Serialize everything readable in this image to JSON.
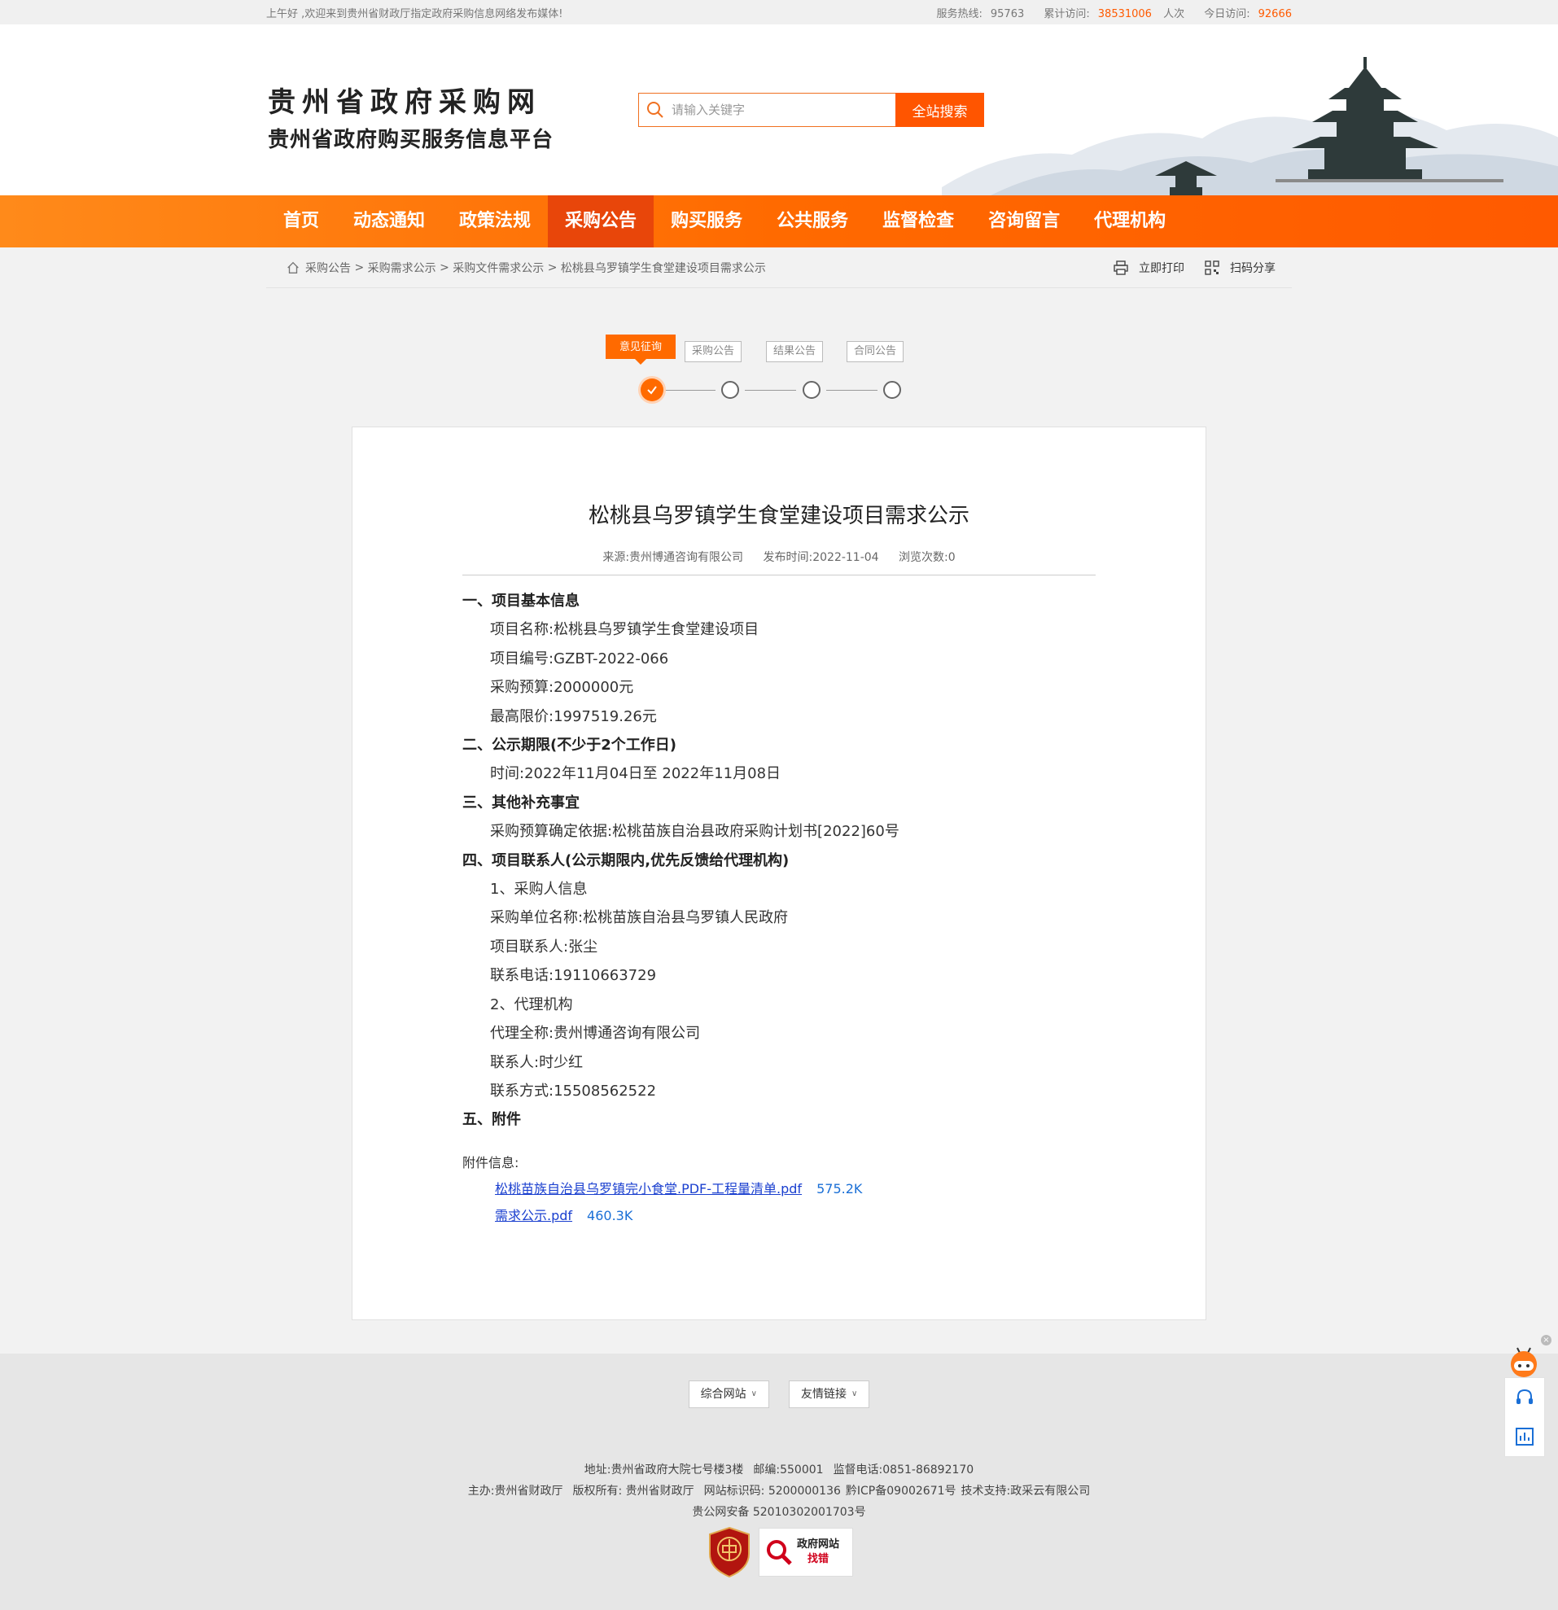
{
  "topbar": {
    "welcome": "上午好 ,欢迎来到贵州省财政厅指定政府采购信息网络发布媒体!",
    "hotline_label": "服务热线:",
    "hotline": "95763",
    "total_label": "累计访问:",
    "total_value": "38531006",
    "total_unit": "人次",
    "today_label": "今日访问:",
    "today_value": "92666"
  },
  "header": {
    "logo_line1": "贵州省政府采购网",
    "logo_line2": "贵州省政府购买服务信息平台",
    "search_placeholder": "请输入关键字",
    "search_button": "全站搜索"
  },
  "nav": {
    "items": [
      "首页",
      "动态通知",
      "政策法规",
      "采购公告",
      "购买服务",
      "公共服务",
      "监督检查",
      "咨询留言",
      "代理机构"
    ],
    "active_index": 3
  },
  "breadcrumb": {
    "c1": "采购公告",
    "c2": "采购需求公示",
    "c3": "采购文件需求公示",
    "c4": "松桃县乌罗镇学生食堂建设项目需求公示",
    "sep": ">",
    "print": "立即打印",
    "share": "扫码分享"
  },
  "steps": [
    "意见征询",
    "采购公告",
    "结果公告",
    "合同公告"
  ],
  "article": {
    "title": "松桃县乌罗镇学生食堂建设项目需求公示",
    "source": "来源:贵州博通咨询有限公司",
    "date": "发布时间:2022-11-04",
    "views": "浏览次数:0",
    "lines": [
      {
        "t": "h",
        "text": "一、项目基本信息"
      },
      {
        "t": "p",
        "text": "项目名称:松桃县乌罗镇学生食堂建设项目"
      },
      {
        "t": "p",
        "text": "项目编号:GZBT-2022-066"
      },
      {
        "t": "p",
        "text": "采购预算:2000000元"
      },
      {
        "t": "p",
        "text": "最高限价:1997519.26元"
      },
      {
        "t": "h",
        "text": "二、公示期限(不少于2个工作日)"
      },
      {
        "t": "p",
        "text": "时间:2022年11月04日至 2022年11月08日"
      },
      {
        "t": "h",
        "text": "三、其他补充事宜"
      },
      {
        "t": "p",
        "text": "采购预算确定依据:松桃苗族自治县政府采购计划书[2022]60号"
      },
      {
        "t": "h",
        "text": "四、项目联系人(公示期限内,优先反馈给代理机构)"
      },
      {
        "t": "p",
        "text": "1、采购人信息"
      },
      {
        "t": "p",
        "text": "采购单位名称:松桃苗族自治县乌罗镇人民政府"
      },
      {
        "t": "p",
        "text": "项目联系人:张尘"
      },
      {
        "t": "p",
        "text": "联系电话:19110663729"
      },
      {
        "t": "p",
        "text": "2、代理机构"
      },
      {
        "t": "p",
        "text": "代理全称:贵州博通咨询有限公司"
      },
      {
        "t": "p",
        "text": "联系人:时少红"
      },
      {
        "t": "p",
        "text": "联系方式:15508562522"
      },
      {
        "t": "h",
        "text": "五、附件"
      }
    ],
    "attach_title": "附件信息:",
    "attachments": [
      {
        "name": "松桃苗族自治县乌罗镇完小食堂.PDF-工程量清单.pdf",
        "size": "575.2K"
      },
      {
        "name": "需求公示.pdf",
        "size": "460.3K"
      }
    ]
  },
  "footer": {
    "btn1": "综合网站",
    "btn2": "友情链接",
    "addr": "地址:贵州省政府大院七号楼3楼",
    "zip": "邮编:550001",
    "tel": "监督电话:0851-86892170",
    "host": "主办:贵州省财政厅",
    "copy": "版权所有: 贵州省财政厅",
    "code": "网站标识码: 5200000136",
    "icp": "黔ICP备09002671号",
    "tech": "技术支持:政采云有限公司",
    "police": "贵公网安备 52010302001703号",
    "badge_text1": "政府网站",
    "badge_text2": "找错"
  },
  "colors": {
    "accent": "#ff6a00",
    "nav_active": "#e8460a",
    "link": "#1a3fcf"
  }
}
